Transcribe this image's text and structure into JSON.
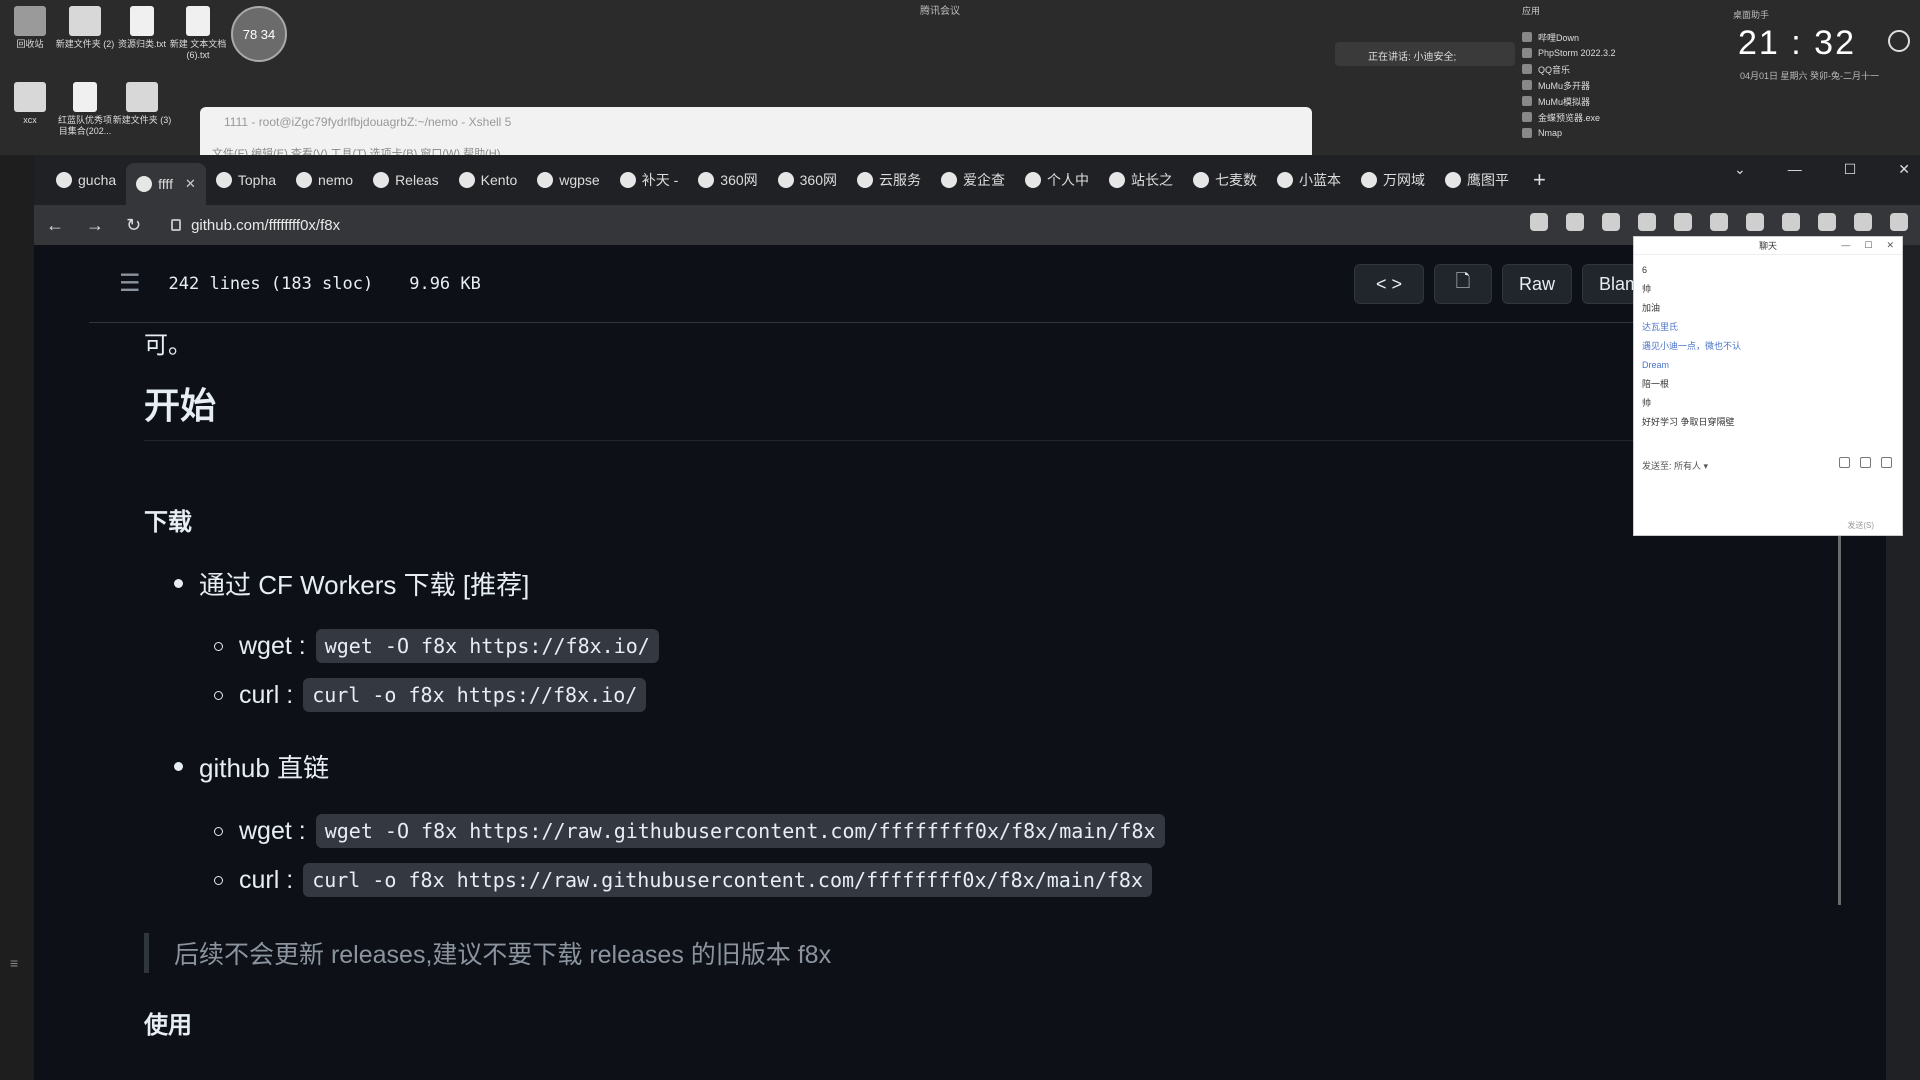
{
  "desktop": {
    "icons": [
      {
        "label": "回收站"
      },
      {
        "label": "新建文件夹 (2)"
      },
      {
        "label": "资源归类.txt"
      },
      {
        "label": "新建 文本文档 (6).txt"
      },
      {
        "label": "xcx"
      },
      {
        "label": "红蓝队优秀项目集合(202..."
      },
      {
        "label": "新建文件夹 (3)"
      }
    ],
    "circle_value": "78 34",
    "meeting_note": "腾讯会议",
    "speaking": "正在讲话: 小迪安全;",
    "apps_title": "应用",
    "apps": [
      "哔哩Down",
      "PhpStorm 2022.3.2",
      "QQ音乐",
      "MuMu多开器",
      "MuMu模拟器",
      "金蝶预览器.exe",
      "Nmap"
    ],
    "desk_label": "桌面助手",
    "clock": "21 : 32",
    "clock_sub": "04月01日  星期六  癸卯-兔-二月十一"
  },
  "xshell": {
    "title": "1111 - root@iZgc79fydrlfbjdouagrbZ:~/nemo - Xshell 5",
    "menu": "文件(F)  编辑(E)  查看(V)  工具(T)  选项卡(B)  窗口(W)  帮助(H)"
  },
  "browser": {
    "tabs": [
      {
        "label": "gucha"
      },
      {
        "label": "ffff",
        "active": true
      },
      {
        "label": "Topha"
      },
      {
        "label": "nemo"
      },
      {
        "label": "Releas"
      },
      {
        "label": "Kento"
      },
      {
        "label": "wgpse"
      },
      {
        "label": "补天 -"
      },
      {
        "label": "360网"
      },
      {
        "label": "360网"
      },
      {
        "label": "云服务"
      },
      {
        "label": "爱企查"
      },
      {
        "label": "个人中"
      },
      {
        "label": "站长之"
      },
      {
        "label": "七麦数"
      },
      {
        "label": "小蓝本"
      },
      {
        "label": "万网域"
      },
      {
        "label": "鹰图平"
      }
    ],
    "url": "github.com/ffffffff0x/f8x"
  },
  "file_header": {
    "lines": "242 lines (183 sloc)",
    "size": "9.96 KB",
    "raw": "Raw",
    "blame": "Blame"
  },
  "readme": {
    "fragment": "可。",
    "h2_start": "开始",
    "h3_download": "下载",
    "cf_bullet": "通过 CF Workers 下载 [推荐]",
    "cf_items": [
      {
        "label": "wget :",
        "code": "wget -O f8x https://f8x.io/"
      },
      {
        "label": "curl :",
        "code": "curl -o f8x https://f8x.io/"
      }
    ],
    "gh_bullet": "github 直链",
    "gh_items": [
      {
        "label": "wget :",
        "code": "wget -O f8x https://raw.githubusercontent.com/ffffffff0x/f8x/main/f8x"
      },
      {
        "label": "curl :",
        "code": "curl -o f8x https://raw.githubusercontent.com/ffffffff0x/f8x/main/f8x"
      }
    ],
    "note": "后续不会更新 releases,建议不要下载 releases 的旧版本 f8x",
    "h3_use": "使用"
  },
  "chat": {
    "title": "聊天",
    "messages": [
      {
        "text": "6",
        "color": "normal"
      },
      {
        "text": "帅",
        "color": "normal"
      },
      {
        "text": "加油",
        "color": "normal"
      },
      {
        "text": "达瓦里氏",
        "color": "blue"
      },
      {
        "text": "遇见小迪一点，微也不认",
        "color": "blue"
      },
      {
        "text": "Dream",
        "color": "blue"
      },
      {
        "text": "陪一根",
        "color": "normal"
      },
      {
        "text": "帅",
        "color": "normal"
      },
      {
        "text": "好好学习 争取日穿隔壁",
        "color": "normal"
      }
    ],
    "send_to": "发送至:  所有人 ▾",
    "send": "发送(S)"
  }
}
